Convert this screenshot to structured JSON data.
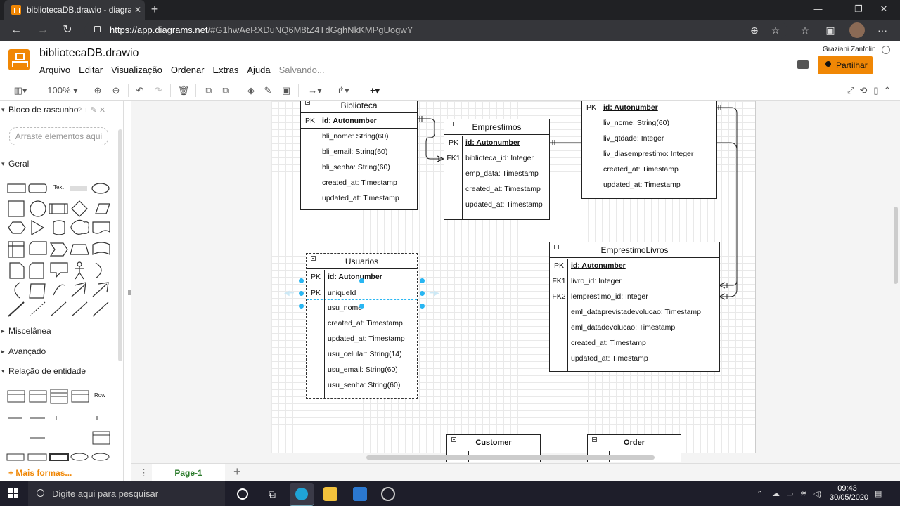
{
  "browser": {
    "tab_title": "bibliotecaDB.drawio - diagrams.n",
    "url_host": "https://app.diagrams.net",
    "url_rest": "/#G1hwAeRXDuNQ6M8tZ4TdGghNkKMPgUogwY"
  },
  "app": {
    "doc_title": "bibliotecaDB.drawio",
    "menus": [
      "Arquivo",
      "Editar",
      "Visualização",
      "Ordenar",
      "Extras",
      "Ajuda"
    ],
    "saving": "Salvando...",
    "user": "Graziani Zanfolin",
    "share_label": "Partilhar",
    "zoom": "100%"
  },
  "sidebar": {
    "scratch_title": "Bloco de rascunho",
    "scratch_drop": "Arraste elementos aqui",
    "general": "Geral",
    "text_shape": "Text",
    "misc": "Miscelânea",
    "advanced": "Avançado",
    "er": "Relação de entidade",
    "row_shape": "Row",
    "more_shapes": "+ Mais formas..."
  },
  "entities": {
    "biblioteca": {
      "title": "Biblioteca",
      "pk_key": "PK",
      "pk": "id: Autonumber",
      "fields": [
        "bli_nome: String(60)",
        "bli_email: String(60)",
        "bli_senha: String(60)",
        "created_at: Timestamp",
        "updated_at: Timestamp"
      ]
    },
    "emprestimos": {
      "title": "Emprestimos",
      "pk_key": "PK",
      "pk": "id: Autonumber",
      "fk_key": "FK1",
      "fields": [
        "biblioteca_id: Integer",
        "emp_data: Timestamp",
        "created_at: Timestamp",
        "updated_at: Timestamp"
      ]
    },
    "livros": {
      "pk_key": "PK",
      "pk": "id: Autonumber",
      "fields": [
        "liv_nome: String(60)",
        "liv_qtdade: Integer",
        "liv_diasemprestimo: Integer",
        "created_at: Timestamp",
        "updated_at: Timestamp"
      ]
    },
    "usuarios": {
      "title": "Usuarios",
      "pk_key": "PK",
      "pk": "id: Autonumber",
      "pk2_key": "PK",
      "pk2": "uniqueId",
      "fields": [
        "usu_nome",
        "created_at: Timestamp",
        "updated_at: Timestamp",
        "usu_celular: String(14)",
        "usu_email: String(60)",
        "usu_senha: String(60)"
      ]
    },
    "emprestimolivros": {
      "title": "EmprestimoLivros",
      "pk_key": "PK",
      "pk": "id: Autonumber",
      "fk1_key": "FK1",
      "fk2_key": "FK2",
      "fields": [
        "livro_id: Integer",
        "lemprestimo_id: Integer",
        "eml_dataprevistadevolucao: Timestamp",
        "eml_datadevolucao: Timestamp",
        "created_at: Timestamp",
        "updated_at: Timestamp"
      ]
    },
    "customer": {
      "title": "Customer"
    },
    "order": {
      "title": "Order"
    }
  },
  "pages": {
    "current": "Page-1"
  },
  "taskbar": {
    "search_placeholder": "Digite aqui para pesquisar",
    "time": "09:43",
    "date": "30/05/2020"
  }
}
